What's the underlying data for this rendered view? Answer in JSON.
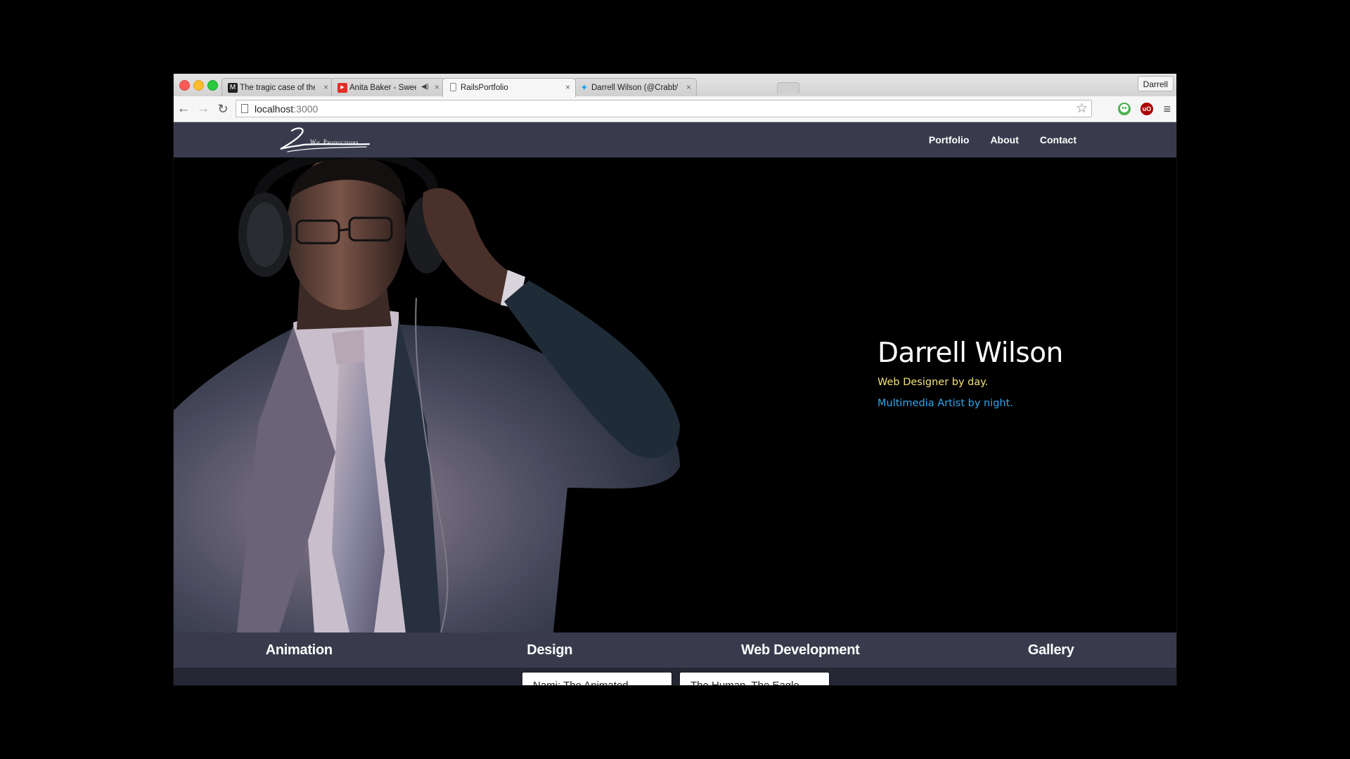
{
  "browser": {
    "tabs": [
      {
        "title": "The tragic case of the boy",
        "favicon": "medium-icon",
        "favicon_color": "#222222",
        "favicon_glyph": "M",
        "active": false
      },
      {
        "title": "Anita Baker - Sweet Lo",
        "favicon": "youtube-icon",
        "favicon_color": "#e52d27",
        "favicon_glyph": "▶",
        "active": false,
        "muted": true
      },
      {
        "title": "RailsPortfolio",
        "favicon": "page-icon",
        "favicon_color": "#ffffff",
        "favicon_glyph": "",
        "active": true
      },
      {
        "title": "Darrell Wilson (@CrabbWa",
        "favicon": "twitter-icon",
        "favicon_color": "#1da1f2",
        "favicon_glyph": "✦",
        "active": false
      }
    ],
    "close_glyph": "×",
    "mute_glyph": "◀)",
    "profile_name": "Darrell",
    "url_host": "localhost",
    "url_port": ":3000",
    "back_glyph": "←",
    "forward_glyph": "→",
    "reload_glyph": "↻",
    "star_glyph": "☆",
    "menu_glyph": "≡",
    "ext_ublock": "uO"
  },
  "site": {
    "logo_text": "Wil Productions",
    "nav": [
      {
        "label": "Portfolio"
      },
      {
        "label": "About"
      },
      {
        "label": "Contact"
      }
    ],
    "hero": {
      "name": "Darrell Wilson",
      "tagline_day": "Web Designer by day.",
      "tagline_night": "Multimedia Artist by night."
    },
    "categories": [
      {
        "label": "Animation"
      },
      {
        "label": "Design"
      },
      {
        "label": "Web Development"
      },
      {
        "label": "Gallery"
      }
    ],
    "cards": [
      {
        "title": "Nami: The Animated"
      },
      {
        "title": "The Human, The Eagle"
      }
    ]
  },
  "colors": {
    "nav_bg": "#393b4d",
    "tagline_day": "#f2e27a",
    "tagline_night": "#2ea8f0"
  }
}
